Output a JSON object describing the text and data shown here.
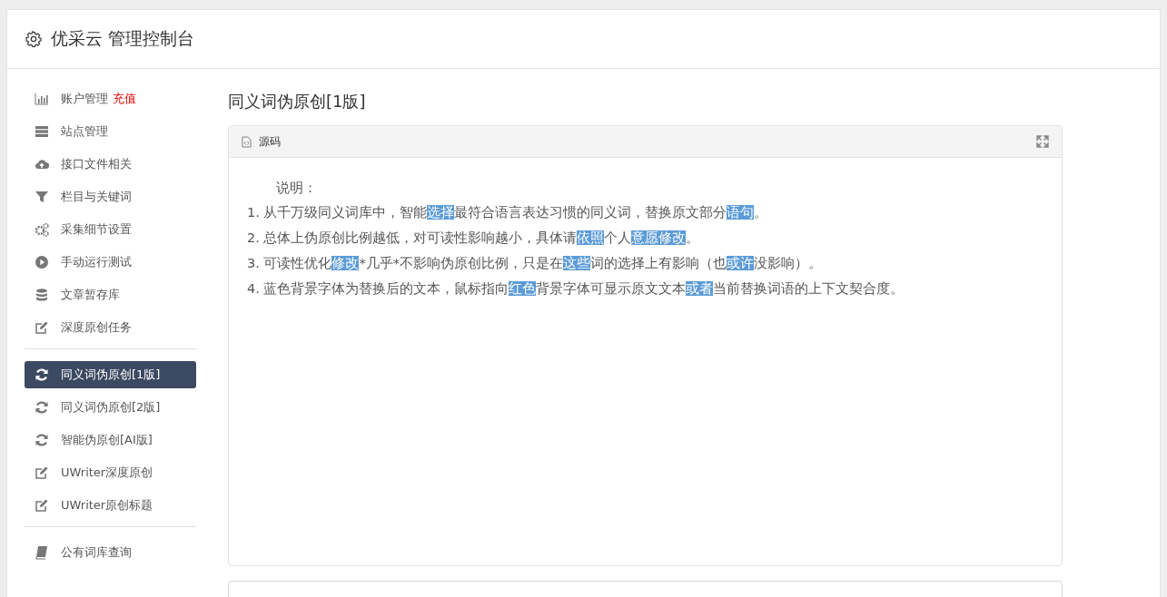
{
  "header": {
    "title": "优采云 管理控制台"
  },
  "sidebar": {
    "groups": [
      {
        "items": [
          {
            "kind": "chart",
            "label": "账户管理",
            "badge": "充值",
            "selected": false
          },
          {
            "kind": "server",
            "label": "站点管理",
            "selected": false
          },
          {
            "kind": "cloud",
            "label": "接口文件相关",
            "selected": false
          },
          {
            "kind": "filter",
            "label": "栏目与关键词",
            "selected": false
          },
          {
            "kind": "gears",
            "label": "采集细节设置",
            "selected": false
          },
          {
            "kind": "play",
            "label": "手动运行测试",
            "selected": false
          },
          {
            "kind": "database",
            "label": "文章暂存库",
            "selected": false
          },
          {
            "kind": "edit",
            "label": "深度原创任务",
            "selected": false
          }
        ]
      },
      {
        "items": [
          {
            "kind": "refresh",
            "label": "同义词伪原创[1版]",
            "selected": true
          },
          {
            "kind": "refresh",
            "label": "同义词伪原创[2版]",
            "selected": false
          },
          {
            "kind": "refresh",
            "label": "智能伪原创[AI版]",
            "selected": false
          },
          {
            "kind": "edit",
            "label": "UWriter深度原创",
            "selected": false
          },
          {
            "kind": "edit",
            "label": "UWriter原创标题",
            "selected": false
          }
        ]
      },
      {
        "items": [
          {
            "kind": "book",
            "label": "公有词库查询",
            "selected": false
          }
        ]
      }
    ]
  },
  "main": {
    "title": "同义词伪原创[1版]",
    "panel": {
      "tab": "源码",
      "intro": "说明：",
      "lines": [
        [
          {
            "text": "1. 从千万级同义词库中，智能",
            "highlighted": false
          },
          {
            "text": "选择",
            "highlighted": true
          },
          {
            "text": "最符合语言表达习惯的同义词，替换原文部分",
            "highlighted": false
          },
          {
            "text": "语句",
            "highlighted": true
          },
          {
            "text": "。",
            "highlighted": false
          }
        ],
        [
          {
            "text": "2. 总体上伪原创比例越低，对可读性影响越小，具体请",
            "highlighted": false
          },
          {
            "text": "依照",
            "highlighted": true
          },
          {
            "text": "个人",
            "highlighted": false
          },
          {
            "text": "意愿",
            "highlighted": true
          },
          {
            "text": "修改",
            "highlighted": true
          },
          {
            "text": "。",
            "highlighted": false
          }
        ],
        [
          {
            "text": "3. 可读性优化",
            "highlighted": false
          },
          {
            "text": "修改",
            "highlighted": true
          },
          {
            "text": "*几乎*不影响伪原创比例，只是在",
            "highlighted": false
          },
          {
            "text": "这些",
            "highlighted": true
          },
          {
            "text": "词的选择上有影响（也",
            "highlighted": false
          },
          {
            "text": "或许",
            "highlighted": true
          },
          {
            "text": "没影响）。",
            "highlighted": false
          }
        ],
        [
          {
            "text": "4. 蓝色背景字体为替换后的文本，鼠标指向",
            "highlighted": false
          },
          {
            "text": "红色",
            "highlighted": true
          },
          {
            "text": "背景字体可显示原文文本",
            "highlighted": false
          },
          {
            "text": "或者",
            "highlighted": true
          },
          {
            "text": "当前替换词语的上下文契合度。",
            "highlighted": false
          }
        ]
      ]
    }
  }
}
